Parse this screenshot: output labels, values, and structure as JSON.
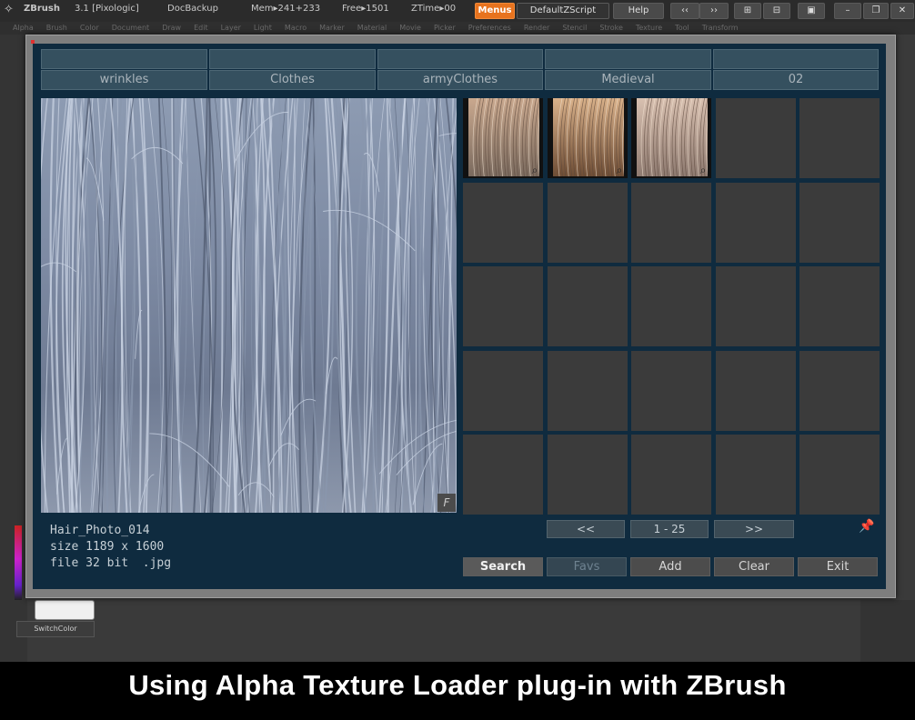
{
  "topbar": {
    "app_name": "ZBrush",
    "version": "3.1 [Pixologic]",
    "doc_backup": "DocBackup",
    "mem": "Mem▸241+233",
    "free": "Free▸1501",
    "ztime": "ZTime▸00",
    "menus_label": "Menus",
    "default_zscript": "DefaultZScript",
    "help": "Help"
  },
  "menu_bar": [
    "Alpha",
    "Brush",
    "Color",
    "Document",
    "Draw",
    "Edit",
    "Layer",
    "Light",
    "Macro",
    "Marker",
    "Material",
    "Movie",
    "Picker",
    "Preferences",
    "Render",
    "Stencil",
    "Stroke",
    "Texture",
    "Tool",
    "Transform"
  ],
  "categories_row1": [
    "",
    "",
    "",
    "",
    ""
  ],
  "categories_row2": [
    "wrinkles",
    "Clothes",
    "armyClothes",
    "Medieval",
    "02"
  ],
  "preview": {
    "badge": "F",
    "colors": {
      "light": "#c8d2e2",
      "mid": "#8a97ae",
      "dark": "#505b70"
    }
  },
  "file_info": {
    "name": "Hair_Photo_014",
    "size": "size 1189 x 1600",
    "file": "file 32 bit  .jpg"
  },
  "pager": {
    "prev": "<<",
    "range": "1 - 25",
    "next": ">>"
  },
  "actions": {
    "search": "Search",
    "favs": "Favs",
    "add": "Add",
    "clear": "Clear",
    "exit": "Exit"
  },
  "switch_color_label": "SwitchColor",
  "caption": "Using Alpha Texture Loader plug-in with ZBrush",
  "icons": {
    "zoom": "magnifier-icon",
    "pin": "pin-icon"
  }
}
